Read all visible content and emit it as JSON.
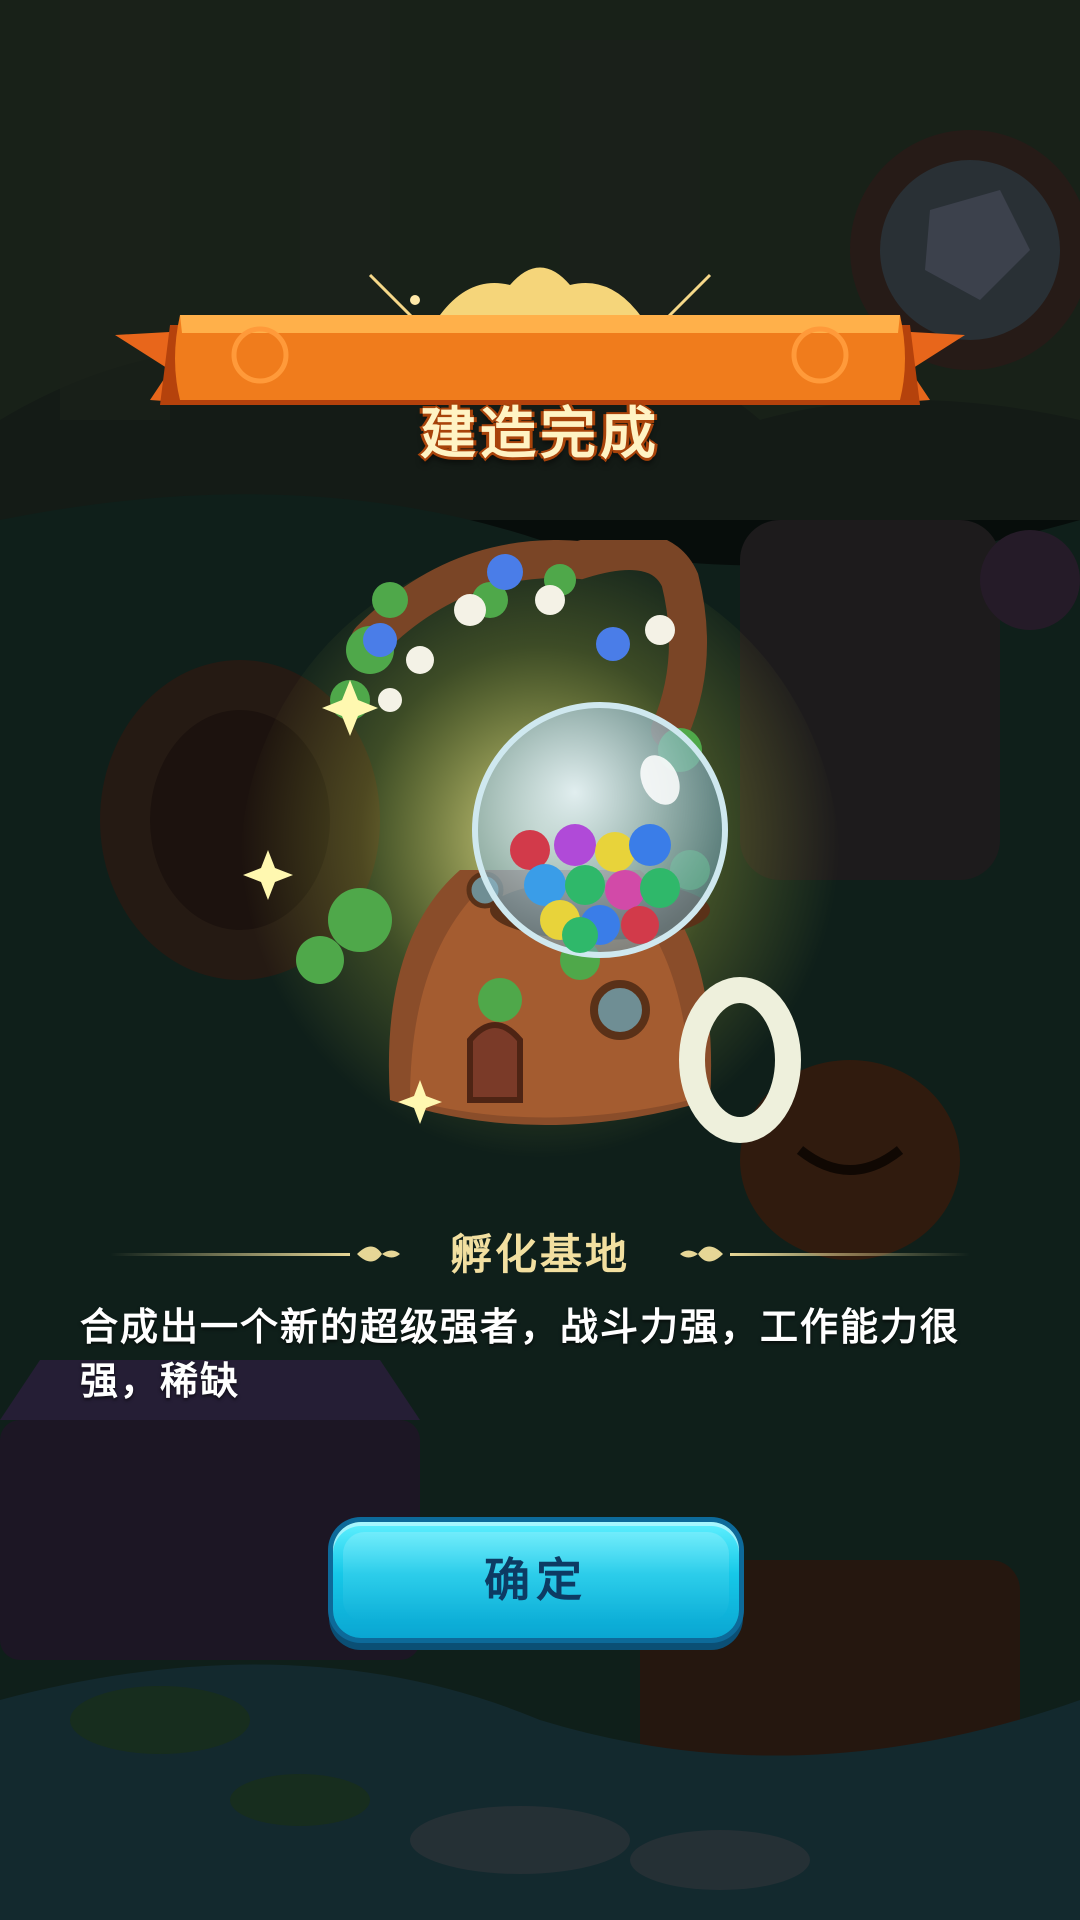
{
  "dialog": {
    "banner_title": "建造完成",
    "building_name": "孵化基地",
    "description": "合成出一个新的超级强者，战斗力强，工作能力很强，稀缺",
    "confirm_label": "确定"
  },
  "colors": {
    "banner_orange": "#f07c1c",
    "banner_text": "#fff3c4",
    "name_gold": "#f2dfa0",
    "button_cyan": "#16c8e8",
    "button_text": "#0d3b63"
  },
  "icons": [
    "sun-crest-icon",
    "ribbon-banner",
    "sparkle-icon",
    "bubble-globe-icon",
    "divider-ornament-icon"
  ]
}
